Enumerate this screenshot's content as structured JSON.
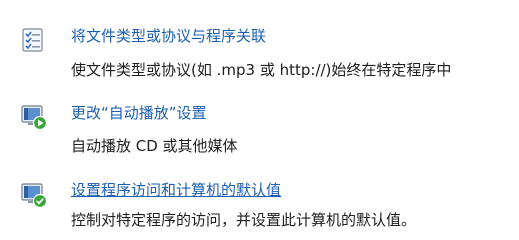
{
  "items": [
    {
      "link": "将文件类型或协议与程序关联",
      "description": "使文件类型或协议(如 .mp3 或 http://)始终在特定程序中",
      "icon": "file-association-icon"
    },
    {
      "link": "更改“自动播放”设置",
      "description": "自动播放 CD 或其他媒体",
      "icon": "autoplay-icon"
    },
    {
      "link": "设置程序访问和计算机的默认值",
      "description": "控制对特定程序的访问，并设置此计算机的默认值。",
      "icon": "program-access-defaults-icon"
    }
  ]
}
